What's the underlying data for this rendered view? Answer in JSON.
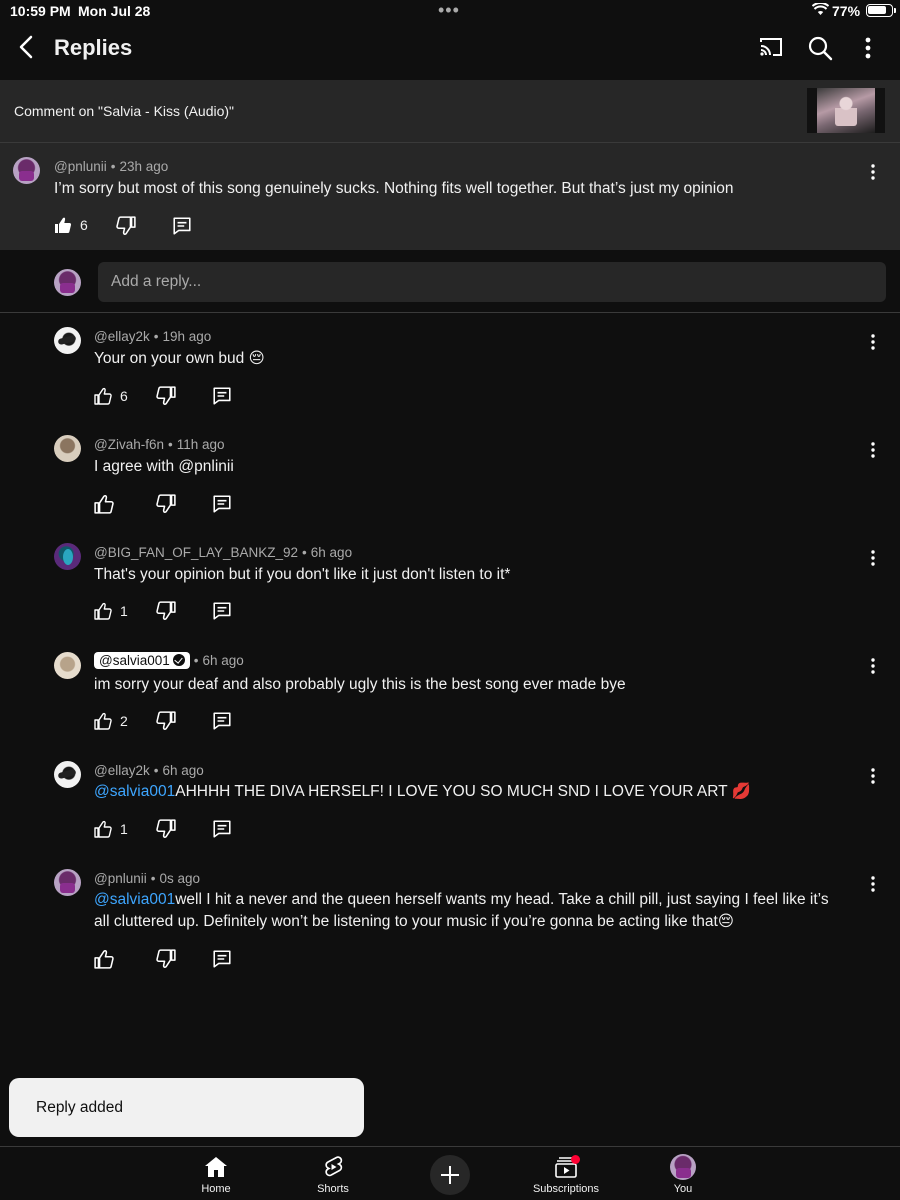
{
  "status_bar": {
    "time": "10:59 PM",
    "date": "Mon Jul 28",
    "dots": "•••",
    "battery": "77%"
  },
  "header": {
    "title": "Replies"
  },
  "context": {
    "text": "Comment on \"Salvia - Kiss (Audio)\""
  },
  "parent": {
    "author": "@pnlunii",
    "time": "23h ago",
    "text": "I’m sorry but most of this song genuinely sucks. Nothing fits well together. But that’s just my opinion",
    "likes": "6"
  },
  "reply_box": {
    "placeholder": "Add a reply..."
  },
  "replies": [
    {
      "author": "@ellay2k",
      "time": "19h ago",
      "text": "Your on your own bud 😔",
      "likes": "6"
    },
    {
      "author": "@Zivah-f6n",
      "time": "11h ago",
      "text": "I agree with @pnlinii",
      "likes": ""
    },
    {
      "author": "@BIG_FAN_OF_LAY_BANKZ_92",
      "time": "6h ago",
      "text": "That's your opinion but if you don't like it just don't listen to it*",
      "likes": "1"
    },
    {
      "author": "@salvia001",
      "time": "6h ago",
      "text": "im sorry your deaf and also probably ugly this is the best song ever made bye",
      "likes": "2"
    },
    {
      "author": "@ellay2k",
      "time": "6h ago",
      "mention": "@salvia001",
      "text": "AHHHH THE DIVA HERSELF! I LOVE YOU SO MUCH SND I LOVE YOUR ART 💋",
      "likes": "1"
    },
    {
      "author": "@pnlunii",
      "time": "0s ago",
      "mention": "@salvia001",
      "text": "well I hit a never and the queen herself wants my head. Take a chill pill, just saying I feel like it’s",
      "text2": "all cluttered up. Definitely won’t be listening to your music if you’re gonna be acting like that😔",
      "likes": ""
    }
  ],
  "toast": {
    "text": "Reply added"
  },
  "nav": {
    "home": "Home",
    "shorts": "Shorts",
    "subscriptions": "Subscriptions",
    "you": "You"
  }
}
